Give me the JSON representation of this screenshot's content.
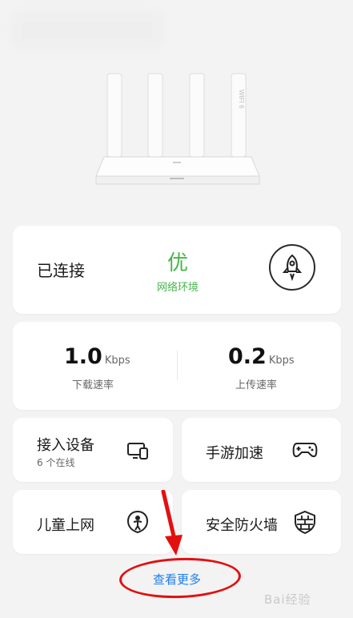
{
  "status": {
    "connection": "已连接",
    "quality": "优",
    "quality_label": "网络环境"
  },
  "speed": {
    "download": {
      "value": "1.0",
      "unit": "Kbps",
      "label": "下载速率"
    },
    "upload": {
      "value": "0.2",
      "unit": "Kbps",
      "label": "上传速率"
    }
  },
  "tiles": {
    "devices": {
      "label": "接入设备",
      "sub": "6 个在线"
    },
    "game": {
      "label": "手游加速"
    },
    "kids": {
      "label": "儿童上网"
    },
    "firewall": {
      "label": "安全防火墙"
    }
  },
  "more": {
    "label": "查看更多"
  },
  "watermark": "Bai经验",
  "router_brand": "WIFI 6",
  "colors": {
    "accent_green": "#45b549",
    "link_blue": "#1a7ef2",
    "annotation_red": "#e30f0f"
  }
}
